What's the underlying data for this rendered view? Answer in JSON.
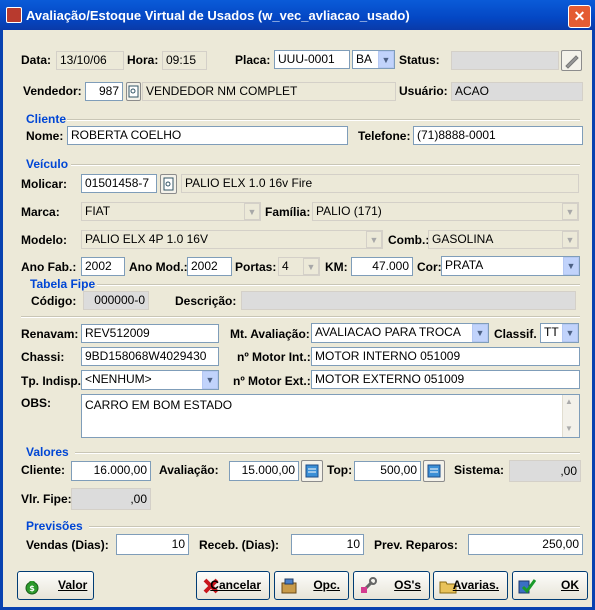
{
  "window": {
    "title": "Avaliação/Estoque Virtual de Usados (w_vec_avliacao_usado)",
    "close_label": "✕"
  },
  "header": {
    "data_label": "Data:",
    "data": "13/10/06",
    "hora_label": "Hora:",
    "hora": "09:15",
    "placa_label": "Placa:",
    "placa": "UUU-0001",
    "uf": "BA",
    "status_label": "Status:",
    "status": "",
    "vendedor_label": "Vendedor:",
    "vendedor_code": "987",
    "vendedor_name": "VENDEDOR NM COMPLET",
    "usuario_label": "Usuário:",
    "usuario": "ACAO"
  },
  "cliente": {
    "section": "Cliente",
    "nome_label": "Nome:",
    "nome": "ROBERTA COELHO",
    "telefone_label": "Telefone:",
    "telefone": "(71)8888-0001"
  },
  "veiculo": {
    "section": "Veículo",
    "molicar_label": "Molicar:",
    "molicar": "01501458-7",
    "molicar_desc": "PALIO ELX 1.0 16v Fire",
    "marca_label": "Marca:",
    "marca": "FIAT",
    "familia_label": "Família:",
    "familia": "PALIO (171)",
    "modelo_label": "Modelo:",
    "modelo": "PALIO ELX 4P 1.0 16V",
    "comb_label": "Comb.:",
    "comb": "GASOLINA",
    "ano_fab_label": "Ano Fab.:",
    "ano_fab": "2002",
    "ano_mod_label": "Ano Mod.:",
    "ano_mod": "2002",
    "portas_label": "Portas:",
    "portas": "4",
    "km_label": "KM:",
    "km": "47.000",
    "cor_label": "Cor:",
    "cor": "PRATA"
  },
  "fipe": {
    "section": "Tabela Fipe",
    "codigo_label": "Código:",
    "codigo": "000000-0",
    "descricao_label": "Descrição:",
    "descricao": ""
  },
  "detalhes": {
    "renavam_label": "Renavam:",
    "renavam": "REV512009",
    "mt_label": "Mt. Avaliação:",
    "mt": "AVALIACAO PARA TROCA",
    "classif_label": "Classif.",
    "classif": "TT",
    "chassi_label": "Chassi:",
    "chassi": "9BD158068W4029430",
    "motor_int_label": "nº Motor Int.:",
    "motor_int": "MOTOR INTERNO 051009",
    "tp_label": "Tp. Indisp.:",
    "tp": "<NENHUM>",
    "motor_ext_label": "nº Motor Ext.:",
    "motor_ext": "MOTOR EXTERNO 051009",
    "obs_label": "OBS:",
    "obs": "CARRO EM BOM ESTADO"
  },
  "valores": {
    "section": "Valores",
    "cliente_label": "Cliente:",
    "cliente": "16.000,00",
    "avaliacao_label": "Avaliação:",
    "avaliacao": "15.000,00",
    "top_label": "Top:",
    "top": "500,00",
    "sistema_label": "Sistema:",
    "sistema": ",00",
    "fipe_label": "Vlr. Fipe:",
    "fipe": ",00"
  },
  "previsoes": {
    "section": "Previsões",
    "vendas_label": "Vendas (Dias):",
    "vendas": "10",
    "receb_label": "Receb. (Dias):",
    "receb": "10",
    "reparos_label": "Prev. Reparos:",
    "reparos": "250,00"
  },
  "buttons": {
    "valor": "Valor",
    "cancelar": "Cancelar",
    "opc": "Opc.",
    "oss": "OS's",
    "avarias": "Avarias.",
    "ok": "OK"
  },
  "colors": {
    "title_bar": "#0447c4",
    "section": "#0046d5",
    "window_bg": "#ece9d8",
    "close": "#e45c33"
  }
}
